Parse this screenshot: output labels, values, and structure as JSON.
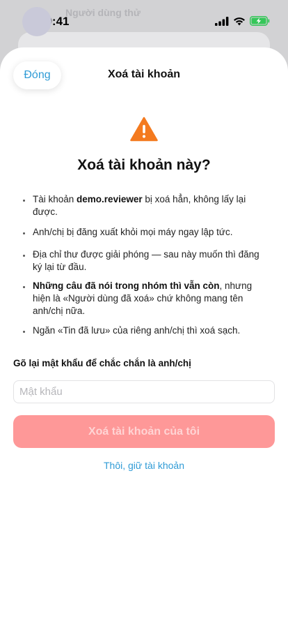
{
  "status_bar": {
    "time": "09:41"
  },
  "background_page": {
    "partial_text": "Người dùng thử"
  },
  "sheet": {
    "close_label": "Đóng",
    "title": "Xoá tài khoản"
  },
  "warning": {
    "icon": "warning-triangle-icon",
    "heading": "Xoá tài khoản này?"
  },
  "bullets": [
    {
      "prefix": "Tài khoản ",
      "bold": "demo.reviewer",
      "suffix": " bị xoá hẳn, không lấy lại được."
    },
    {
      "prefix": "Anh/chị bị đăng xuất khỏi mọi máy ngay lập tức.",
      "bold": "",
      "suffix": ""
    },
    {
      "prefix": "Địa chỉ thư được giải phóng — sau này muốn thì đăng ký lại từ đầu.",
      "bold": "",
      "suffix": ""
    },
    {
      "prefix": "",
      "bold": "Những câu đã nói trong nhóm thì vẫn còn",
      "suffix": ", nhưng hiện là «Người dùng đã xoá» chứ không mang tên anh/chị nữa."
    },
    {
      "prefix": "Ngăn «Tin đã lưu» của riêng anh/chị thì xoá sạch.",
      "bold": "",
      "suffix": ""
    }
  ],
  "password": {
    "label": "Gõ lại mật khẩu để chắc chắn là anh/chị",
    "placeholder": "Mật khẩu",
    "value": ""
  },
  "actions": {
    "delete_label": "Xoá tài khoản của tôi",
    "keep_label": "Thôi, giữ tài khoản"
  },
  "colors": {
    "accent": "#2f9bd6",
    "danger_disabled": "#fe9898",
    "warning": "#f47a1f",
    "battery": "#35c759"
  }
}
